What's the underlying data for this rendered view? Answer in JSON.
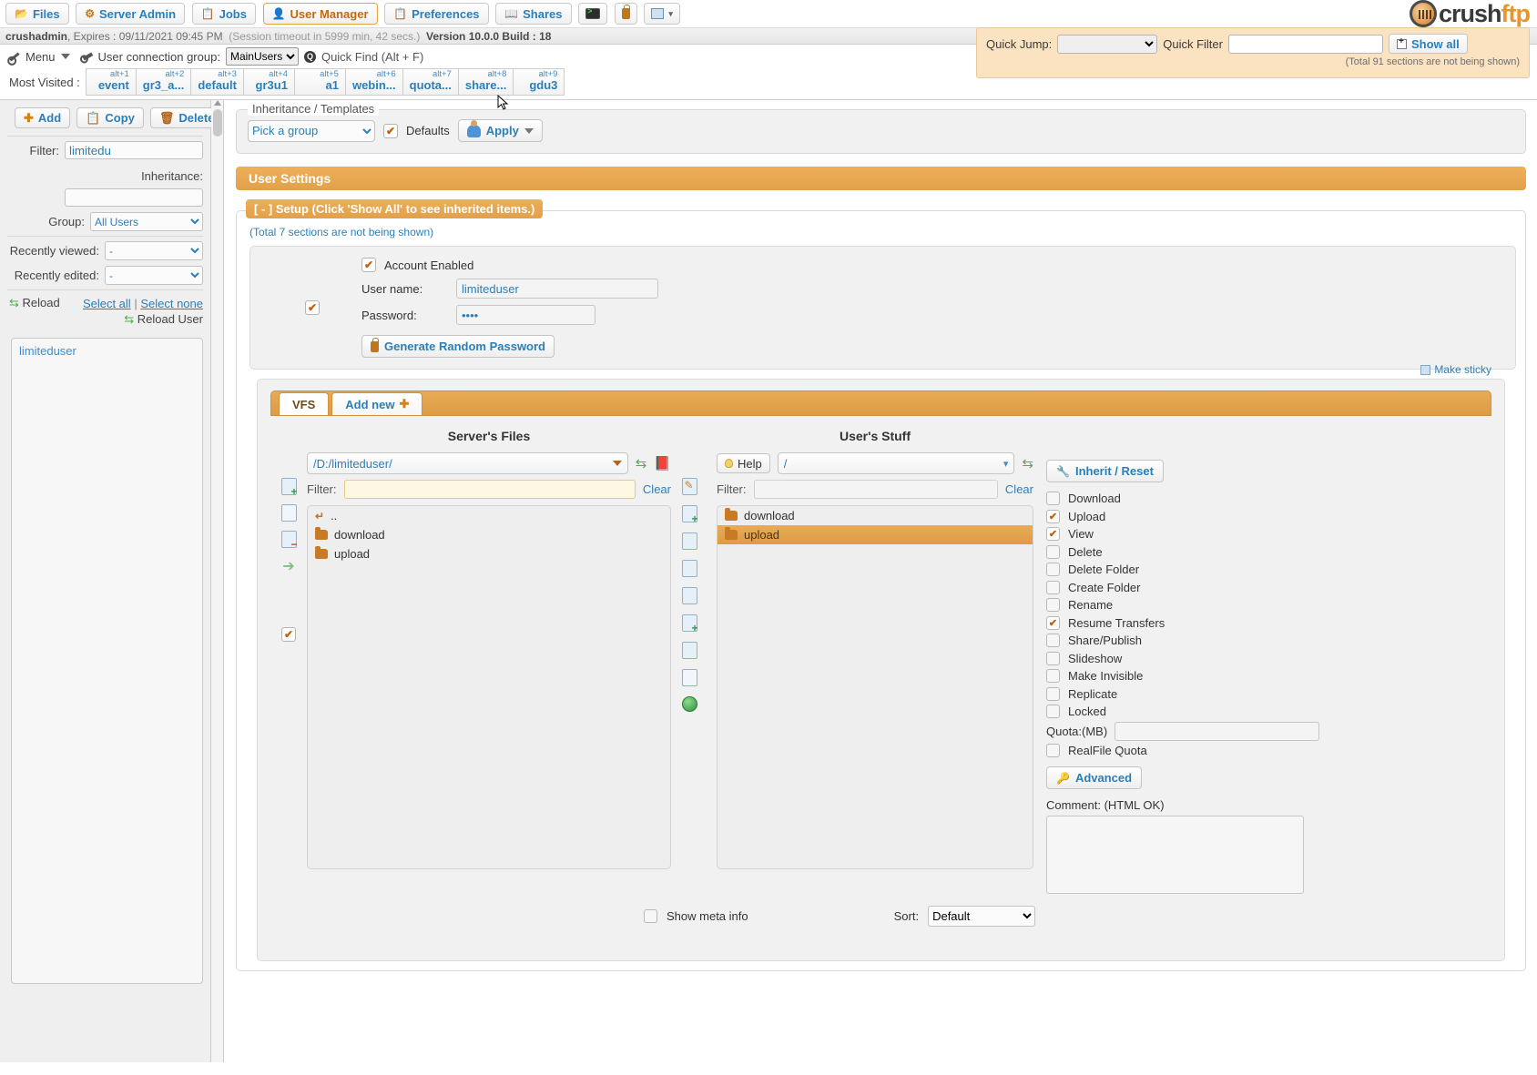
{
  "nav": {
    "items": [
      {
        "label": "Files",
        "icon": "folder-icon",
        "active": false
      },
      {
        "label": "Server Admin",
        "icon": "gear-icon",
        "active": false
      },
      {
        "label": "Jobs",
        "icon": "clipboard-icon",
        "active": false
      },
      {
        "label": "User Manager",
        "icon": "user-icon",
        "active": true
      },
      {
        "label": "Preferences",
        "icon": "clipboard-icon",
        "active": false
      },
      {
        "label": "Shares",
        "icon": "share-icon",
        "active": false
      }
    ],
    "terminal_icon": "terminal-icon",
    "lock_icon": "lock-icon",
    "image_icon": "image-icon"
  },
  "logo": {
    "brand": "crush",
    "suffix": "ftp"
  },
  "status": {
    "user": "crushadmin",
    "expires": ", Expires : 09/11/2021 09:45 PM",
    "session": "(Session timeout in 5999 min, 42 secs.)",
    "version": "Version 10.0.0 Build : 18"
  },
  "quickjump": {
    "jump_label": "Quick Jump:",
    "jump_value": "",
    "filter_label": "Quick Filter",
    "filter_value": "",
    "show_all": "Show all",
    "note": "(Total 91 sections are not being shown)"
  },
  "toolrow": {
    "menu": "Menu",
    "conn_group_label": "User connection group:",
    "conn_group_value": "MainUsers",
    "quickfind": "Quick Find (Alt + F)"
  },
  "most_visited": {
    "label": "Most Visited :",
    "items": [
      {
        "alt": "alt+1",
        "name": "event"
      },
      {
        "alt": "alt+2",
        "name": "gr3_a..."
      },
      {
        "alt": "alt+3",
        "name": "default"
      },
      {
        "alt": "alt+4",
        "name": "gr3u1"
      },
      {
        "alt": "alt+5",
        "name": "a1"
      },
      {
        "alt": "alt+6",
        "name": "webin..."
      },
      {
        "alt": "alt+7",
        "name": "quota..."
      },
      {
        "alt": "alt+8",
        "name": "share..."
      },
      {
        "alt": "alt+9",
        "name": "gdu3"
      }
    ]
  },
  "left": {
    "add": "Add",
    "copy": "Copy",
    "delete": "Delete",
    "filter_label": "Filter:",
    "filter_value": "limitedu",
    "inheritance_label": "Inheritance:",
    "inheritance_value": "",
    "group_label": "Group:",
    "group_value": "All Users",
    "recently_viewed_label": "Recently viewed:",
    "recently_viewed_value": "-",
    "recently_edited_label": "Recently edited:",
    "recently_edited_value": "-",
    "reload": "Reload",
    "select_all": "Select all",
    "sep": "|",
    "select_none": "Select none",
    "reload_user": "Reload User",
    "users": [
      "limiteduser"
    ]
  },
  "inheritance": {
    "legend": "Inheritance / Templates",
    "group_value": "Pick a group",
    "defaults_label": "Defaults",
    "defaults_checked": true,
    "apply": "Apply"
  },
  "user_settings_bar": "User Settings",
  "setup": {
    "legend": "[ - ] Setup (Click 'Show All' to see inherited items.)",
    "note": "(Total 7 sections are not being shown)",
    "section_checked": true,
    "account_enabled_label": "Account Enabled",
    "account_enabled": true,
    "username_label": "User name:",
    "username_value": "limiteduser",
    "password_label": "Password:",
    "password_value": "••••",
    "generate_password": "Generate Random Password"
  },
  "vfs": {
    "make_sticky": "Make sticky",
    "tabs": [
      {
        "label": "VFS",
        "active": true
      },
      {
        "label": "Add new",
        "active": false
      }
    ],
    "server": {
      "title": "Server's Files",
      "path": "/D:/limiteduser/",
      "filter_label": "Filter:",
      "filter_value": "",
      "clear": "Clear",
      "items": [
        {
          "name": "..",
          "type": "up"
        },
        {
          "name": "download",
          "type": "folder"
        },
        {
          "name": "upload",
          "type": "folder"
        }
      ],
      "checkbox_checked": true
    },
    "user": {
      "title": "User's Stuff",
      "help": "Help",
      "path": "/",
      "filter_label": "Filter:",
      "filter_value": "",
      "clear": "Clear",
      "items": [
        {
          "name": "download",
          "type": "folder",
          "selected": false
        },
        {
          "name": "upload",
          "type": "folder",
          "selected": true
        }
      ]
    },
    "permissions": {
      "inherit_reset": "Inherit / Reset",
      "items": [
        {
          "label": "Download",
          "checked": false
        },
        {
          "label": "Upload",
          "checked": true
        },
        {
          "label": "View",
          "checked": true
        },
        {
          "label": "Delete",
          "checked": false
        },
        {
          "label": "Delete Folder",
          "checked": false
        },
        {
          "label": "Create Folder",
          "checked": false
        },
        {
          "label": "Rename",
          "checked": false
        },
        {
          "label": "Resume Transfers",
          "checked": true
        },
        {
          "label": "Share/Publish",
          "checked": false
        },
        {
          "label": "Slideshow",
          "checked": false
        },
        {
          "label": "Make Invisible",
          "checked": false
        },
        {
          "label": "Replicate",
          "checked": false
        },
        {
          "label": "Locked",
          "checked": false
        }
      ],
      "quota_label": "Quota:(MB)",
      "quota_value": "",
      "realfile_quota_label": "RealFile Quota",
      "realfile_quota_checked": false,
      "advanced": "Advanced",
      "comment_label": "Comment: (HTML OK)",
      "comment_value": ""
    },
    "footer": {
      "show_meta_label": "Show meta info",
      "show_meta_checked": false,
      "sort_label": "Sort:",
      "sort_value": "Default"
    }
  },
  "colors": {
    "accent_orange": "#e2a04a",
    "link_blue": "#2a7fba",
    "check_orange": "#c0600f"
  }
}
